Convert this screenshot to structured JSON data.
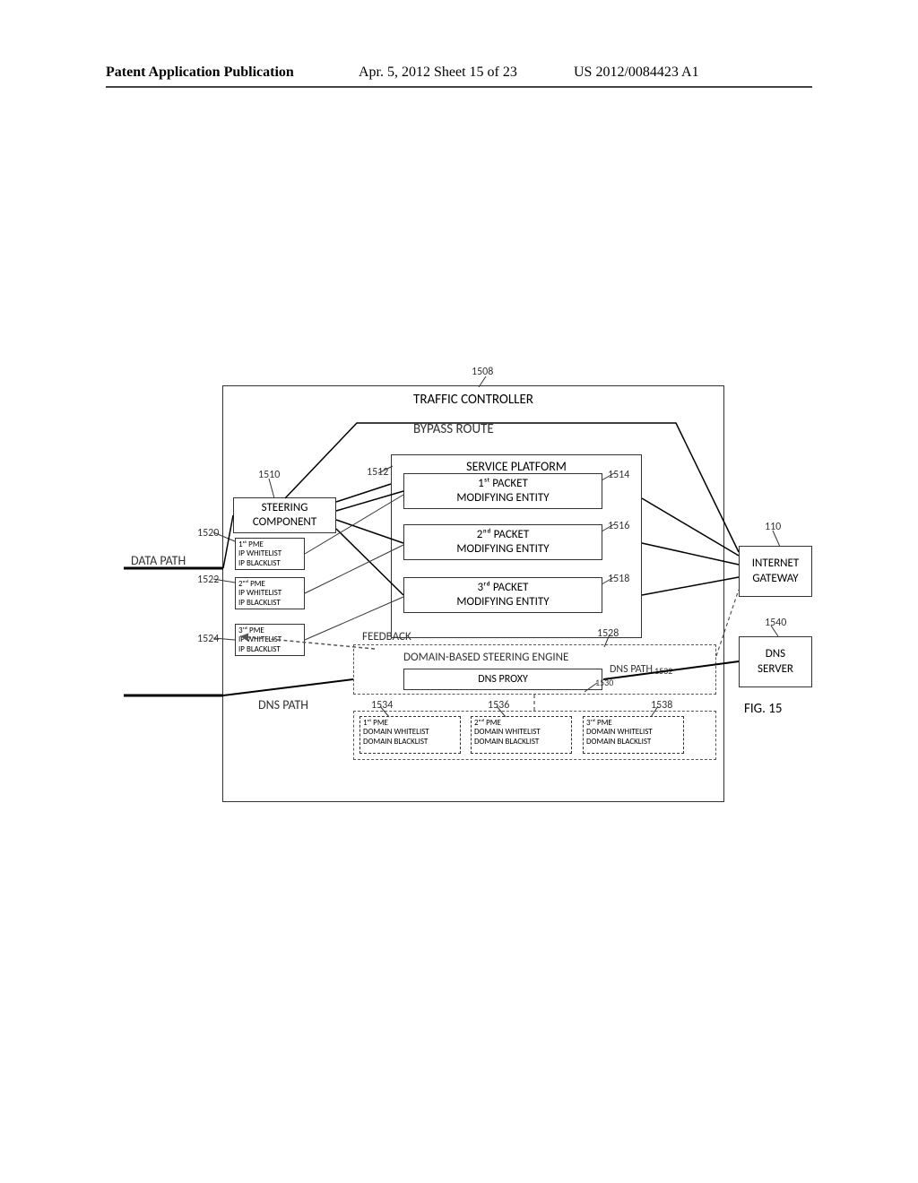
{
  "header": {
    "left": "Patent Application Publication",
    "center": "Apr. 5, 2012  Sheet 15 of 23",
    "right": "US 2012/0084423 A1"
  },
  "figure": {
    "caption": "FIG. 15",
    "traffic_controller": "TRAFFIC CONTROLLER",
    "bypass_route": "BYPASS ROUTE",
    "service_platform": "SERVICE PLATFORM",
    "steering_component": "STEERING\nCOMPONENT",
    "pme1": "1ˢᵗ PACKET\nMODIFYING ENTITY",
    "pme2": "2ⁿᵈ PACKET\nMODIFYING ENTITY",
    "pme3": "3ʳᵈ PACKET\nMODIFYING ENTITY",
    "data_path": "DATA PATH",
    "internet_gateway": "INTERNET\nGATEWAY",
    "dns_server": "DNS\nSERVER",
    "domain_engine": "DOMAIN-BASED STEERING ENGINE",
    "dns_proxy": "DNS PROXY",
    "feedback": "FEEDBACK",
    "dns_path": "DNS PATH",
    "iplist1": {
      "title": "1ˢᵗ PME",
      "wl": "IP WHITELIST",
      "bl": "IP BLACKLIST"
    },
    "iplist2": {
      "title": "2ⁿᵈ PME",
      "wl": "IP WHITELIST",
      "bl": "IP BLACKLIST"
    },
    "iplist3": {
      "title": "3ʳᵈ PME",
      "wl": "IP WHITELIST",
      "bl": "IP BLACKLIST"
    },
    "domlist1": {
      "title": "1ˢᵗ PME",
      "wl": "DOMAIN WHITELIST",
      "bl": "DOMAIN BLACKLIST"
    },
    "domlist2": {
      "title": "2ⁿᵈ PME",
      "wl": "DOMAIN WHITELIST",
      "bl": "DOMAIN BLACKLIST"
    },
    "domlist3": {
      "title": "3ʳᵈ PME",
      "wl": "DOMAIN WHITELIST",
      "bl": "DOMAIN BLACKLIST"
    }
  },
  "refs": {
    "r1508": "1508",
    "r1510": "1510",
    "r1512": "1512",
    "r1514": "1514",
    "r1516": "1516",
    "r1518": "1518",
    "r1520": "1520",
    "r1522": "1522",
    "r1524": "1524",
    "r1528": "1528",
    "r1530": "1530",
    "r1532": "1532",
    "r1534": "1534",
    "r1536": "1536",
    "r1538": "1538",
    "r1540": "1540",
    "r110": "110"
  }
}
